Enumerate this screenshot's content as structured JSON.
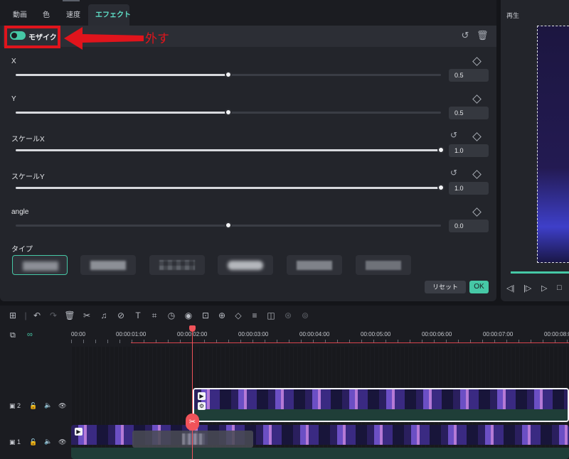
{
  "tabs": [
    "動画",
    "色",
    "速度",
    "エフェクト"
  ],
  "effect": {
    "name": "モザイク",
    "enabled": true
  },
  "annotation": {
    "text": "外す",
    "color": "#e0141c"
  },
  "params": [
    {
      "label": "X",
      "value": "0.5",
      "fraction": 0.5,
      "resettable": false
    },
    {
      "label": "Y",
      "value": "0.5",
      "fraction": 0.5,
      "resettable": false
    },
    {
      "label": "スケールX",
      "value": "1.0",
      "fraction": 1.0,
      "resettable": true
    },
    {
      "label": "スケールY",
      "value": "1.0",
      "fraction": 1.0,
      "resettable": true
    },
    {
      "label": "angle",
      "value": "0.0",
      "fraction": 0.5,
      "resettable": false
    }
  ],
  "type_section": {
    "label": "タイプ",
    "selected_index": 0,
    "count": 6
  },
  "buttons": {
    "reset": "リセット",
    "ok": "OK"
  },
  "preview": {
    "title": "再生"
  },
  "timeline": {
    "timecodes": [
      "00:00",
      "00:00:01:00",
      "00:00:02:00",
      "00:00:03:00",
      "00:00:04:00",
      "00:00:05:00",
      "00:00:06:00",
      "00:00:07:00",
      "00:00:08:0"
    ],
    "tracks": [
      {
        "number": "2"
      },
      {
        "number": "1"
      }
    ]
  },
  "colors": {
    "accent": "#46c8a6",
    "playhead": "#f0535a",
    "panel": "#23252b"
  },
  "icons": [
    "toggle-icon",
    "reset-icon",
    "delete-icon",
    "keyframe-diamond-icon",
    "split-icon",
    "play-icon",
    "lock-icon",
    "speaker-icon",
    "eye-icon"
  ]
}
